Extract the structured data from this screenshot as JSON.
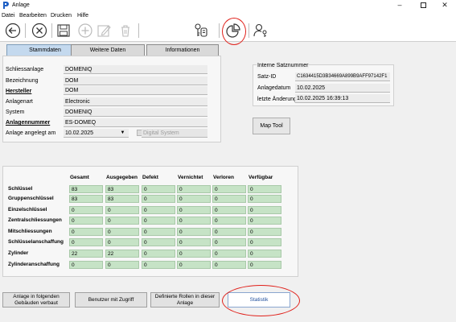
{
  "window": {
    "title": "Anlage"
  },
  "menu": [
    "Datei",
    "Bearbeiten",
    "Drucken",
    "Hilfe"
  ],
  "toolbar": {
    "buttons": [
      "back-icon",
      "cancel-icon",
      "save-icon",
      "add-icon",
      "edit-icon",
      "delete-icon",
      "key-search-icon",
      "statistics-chart-icon",
      "user-key-icon"
    ]
  },
  "tabs": [
    "Stammdaten",
    "Weitere Daten",
    "Informationen"
  ],
  "stamm": {
    "schliessanlage_label": "Schliessanlage",
    "schliessanlage_value": "DOMENIQ",
    "bezeichnung_label": "Bezeichnung",
    "bezeichnung_value": "DOM",
    "hersteller_label": "Hersteller",
    "hersteller_value": "DOM",
    "anlagenart_label": "Anlagenart",
    "anlagenart_value": "Electronic",
    "system_label": "System",
    "system_value": "DOMENIQ",
    "anlagennummer_label": "Anlagennummer",
    "anlagennummer_value": "ES-DOMEQ",
    "angelegt_label": "Anlage angelegt am",
    "angelegt_value": "10.02.2025",
    "digital_label": "Digital System"
  },
  "intern": {
    "header": "Interne Satznummer",
    "satzid_label": "Satz-ID",
    "satzid_value": "C1634415D3B34669A899B9AFF97142F1",
    "datum_label": "Anlagedatum",
    "datum_value": "10.02.2025",
    "aenderung_label": "letzte Änderung",
    "aenderung_value": "10.02.2025 16:39:13",
    "map_tool": "Map Tool"
  },
  "stats": {
    "columns": [
      "Gesamt",
      "Ausgegeben",
      "Defekt",
      "Vernichtet",
      "Verloren",
      "Verfügbar"
    ],
    "rows": [
      {
        "label": "Schlüssel",
        "values": [
          "83",
          "83",
          "0",
          "0",
          "0",
          "0"
        ]
      },
      {
        "label": "Gruppenschlüssel",
        "values": [
          "83",
          "83",
          "0",
          "0",
          "0",
          "0"
        ]
      },
      {
        "label": "Einzelschlüssel",
        "values": [
          "0",
          "0",
          "0",
          "0",
          "0",
          "0"
        ]
      },
      {
        "label": "Zentralschliessungen",
        "values": [
          "0",
          "0",
          "0",
          "0",
          "0",
          "0"
        ]
      },
      {
        "label": "Mitschliessungen",
        "values": [
          "0",
          "0",
          "0",
          "0",
          "0",
          "0"
        ]
      },
      {
        "label": "Schlüsselanschaffung",
        "values": [
          "0",
          "0",
          "0",
          "0",
          "0",
          "0"
        ]
      },
      {
        "label": "Zylinder",
        "values": [
          "22",
          "22",
          "0",
          "0",
          "0",
          "0"
        ]
      },
      {
        "label": "Zylinderanschaffung",
        "values": [
          "0",
          "0",
          "0",
          "0",
          "0",
          "0"
        ]
      }
    ]
  },
  "bottom": {
    "b1": "Anlage in folgenden Gebäuden verbaut",
    "b2": "Benutzer mit Zugriff",
    "b3": "Definierte Rollen in dieser Anlage",
    "b4": "Statistik"
  }
}
